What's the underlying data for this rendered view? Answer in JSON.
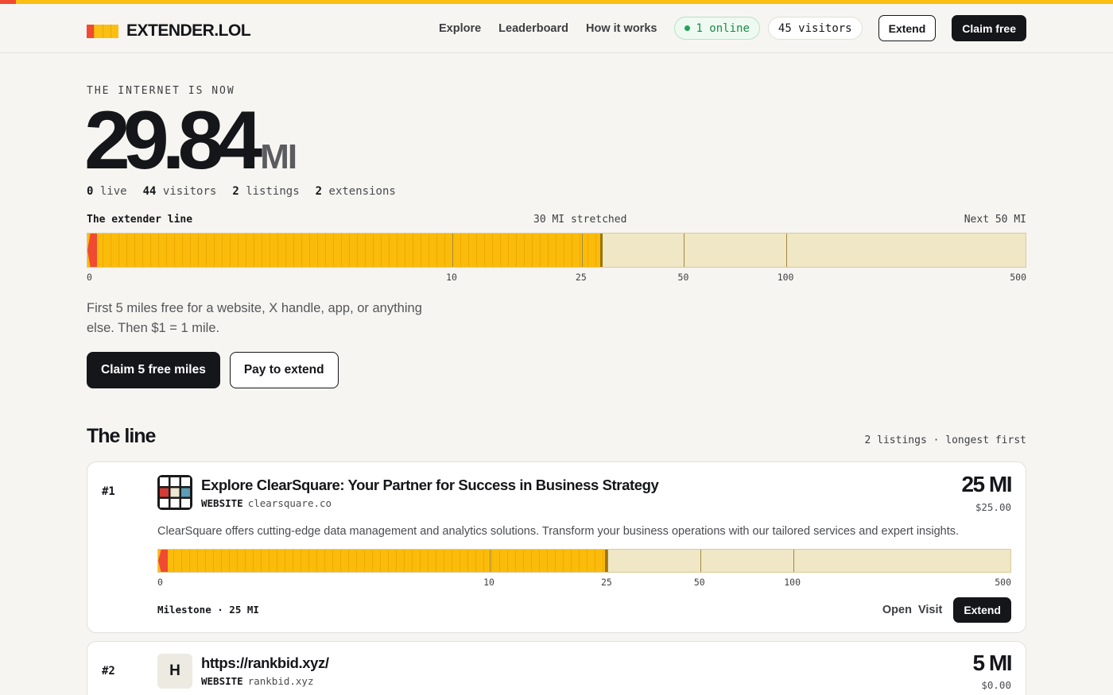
{
  "brand": {
    "name": "EXTENDER.LOL"
  },
  "nav": {
    "links": [
      "Explore",
      "Leaderboard",
      "How it works"
    ],
    "online": "1 online",
    "visitors": "45 visitors",
    "extend_label": "Extend",
    "claim_label": "Claim free"
  },
  "hero": {
    "kicker": "THE INTERNET IS NOW",
    "value": "29.84",
    "unit": "MI"
  },
  "stats": [
    {
      "num": "0",
      "label": "live"
    },
    {
      "num": "44",
      "label": "visitors"
    },
    {
      "num": "2",
      "label": "listings"
    },
    {
      "num": "2",
      "label": "extensions"
    }
  ],
  "line": {
    "title": "The extender line",
    "stretched": "30 MI stretched",
    "next": "Next 50 MI",
    "ticks": [
      "0",
      "10",
      "25",
      "50",
      "100",
      "500"
    ],
    "fill_miles": 30
  },
  "description": "First 5 miles free for a website, X handle, app, or anything else. Then $1 = 1 mile.",
  "cta": {
    "primary": "Claim 5 free miles",
    "secondary": "Pay to extend"
  },
  "section": {
    "title": "The line",
    "meta": "2 listings · longest first"
  },
  "listings": [
    {
      "rank": "#1",
      "title": "Explore ClearSquare: Your Partner for Success in Business Strategy",
      "type": "WEBSITE",
      "domain": "clearsquare.co",
      "miles": "25 MI",
      "price": "$25.00",
      "description": "ClearSquare offers cutting-edge data management and analytics solutions. Transform your business operations with our tailored services and expert insights.",
      "fill_miles": 25,
      "ticks": [
        "0",
        "10",
        "25",
        "50",
        "100",
        "500"
      ],
      "milestone": "Milestone · 25 MI",
      "actions": {
        "open": "Open",
        "visit": "Visit",
        "extend": "Extend"
      }
    },
    {
      "rank": "#2",
      "title": "https://rankbid.xyz/",
      "type": "WEBSITE",
      "domain": "rankbid.xyz",
      "initial": "H",
      "miles": "5 MI",
      "price": "$0.00"
    }
  ],
  "colors": {
    "accent": "#fbbf14",
    "red": "#f04a32",
    "dark": "#15161a",
    "track": "#efe7c6"
  }
}
